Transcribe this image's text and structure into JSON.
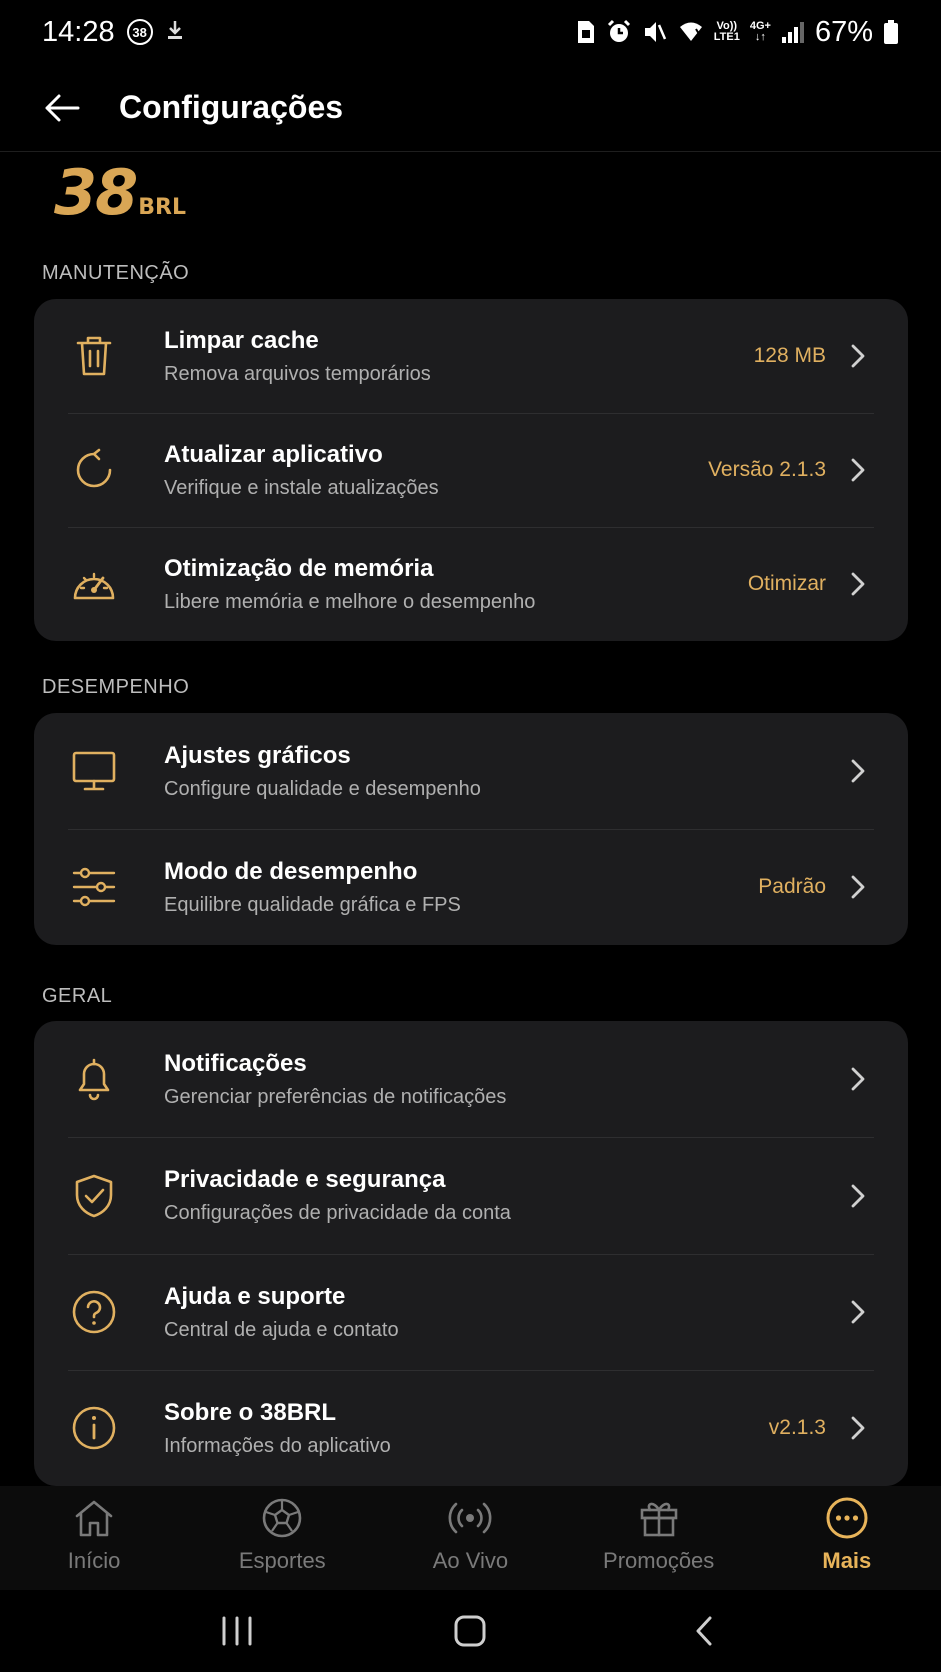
{
  "status_bar": {
    "time": "14:28",
    "notif_badge": "38",
    "net_top": "4G+",
    "volte_top": "Vo))",
    "volte_bottom": "LTE1",
    "battery": "67%"
  },
  "header": {
    "title": "Configurações"
  },
  "brand": {
    "number": "38",
    "suffix": "BRL"
  },
  "sections": {
    "maintenance": {
      "label": "MANUTENÇÃO",
      "items": [
        {
          "title": "Limpar cache",
          "subtitle": "Remova arquivos temporários",
          "value": "128 MB",
          "icon": "trash-icon"
        },
        {
          "title": "Atualizar aplicativo",
          "subtitle": "Verifique e instale atualizações",
          "value": "Versão 2.1.3",
          "icon": "refresh-icon"
        },
        {
          "title": "Otimização de memória",
          "subtitle": "Libere memória e melhore o desempenho",
          "value": "Otimizar",
          "icon": "gauge-icon"
        }
      ]
    },
    "performance": {
      "label": "DESEMPENHO",
      "items": [
        {
          "title": "Ajustes gráficos",
          "subtitle": "Configure qualidade e desempenho",
          "value": "",
          "icon": "monitor-icon"
        },
        {
          "title": "Modo de desempenho",
          "subtitle": "Equilibre qualidade gráfica e FPS",
          "value": "Padrão",
          "icon": "sliders-icon"
        }
      ]
    },
    "general": {
      "label": "GERAL",
      "items": [
        {
          "title": "Notificações",
          "subtitle": "Gerenciar preferências de notificações",
          "value": "",
          "icon": "bell-icon"
        },
        {
          "title": "Privacidade e segurança",
          "subtitle": "Configurações de privacidade da conta",
          "value": "",
          "icon": "shield-check-icon"
        },
        {
          "title": "Ajuda e suporte",
          "subtitle": "Central de ajuda e contato",
          "value": "",
          "icon": "help-circle-icon"
        },
        {
          "title": "Sobre o 38BRL",
          "subtitle": "Informações do aplicativo",
          "value": "v2.1.3",
          "icon": "info-circle-icon"
        }
      ]
    }
  },
  "bottom_nav": {
    "items": [
      {
        "label": "Início",
        "icon": "home-icon"
      },
      {
        "label": "Esportes",
        "icon": "soccer-ball-icon"
      },
      {
        "label": "Ao Vivo",
        "icon": "live-broadcast-icon"
      },
      {
        "label": "Promoções",
        "icon": "gift-icon"
      },
      {
        "label": "Mais",
        "icon": "more-dots-icon"
      }
    ],
    "active": "Mais"
  },
  "colors": {
    "accent": "#e0b060",
    "card_bg": "#1c1c1e",
    "background": "#000000"
  }
}
